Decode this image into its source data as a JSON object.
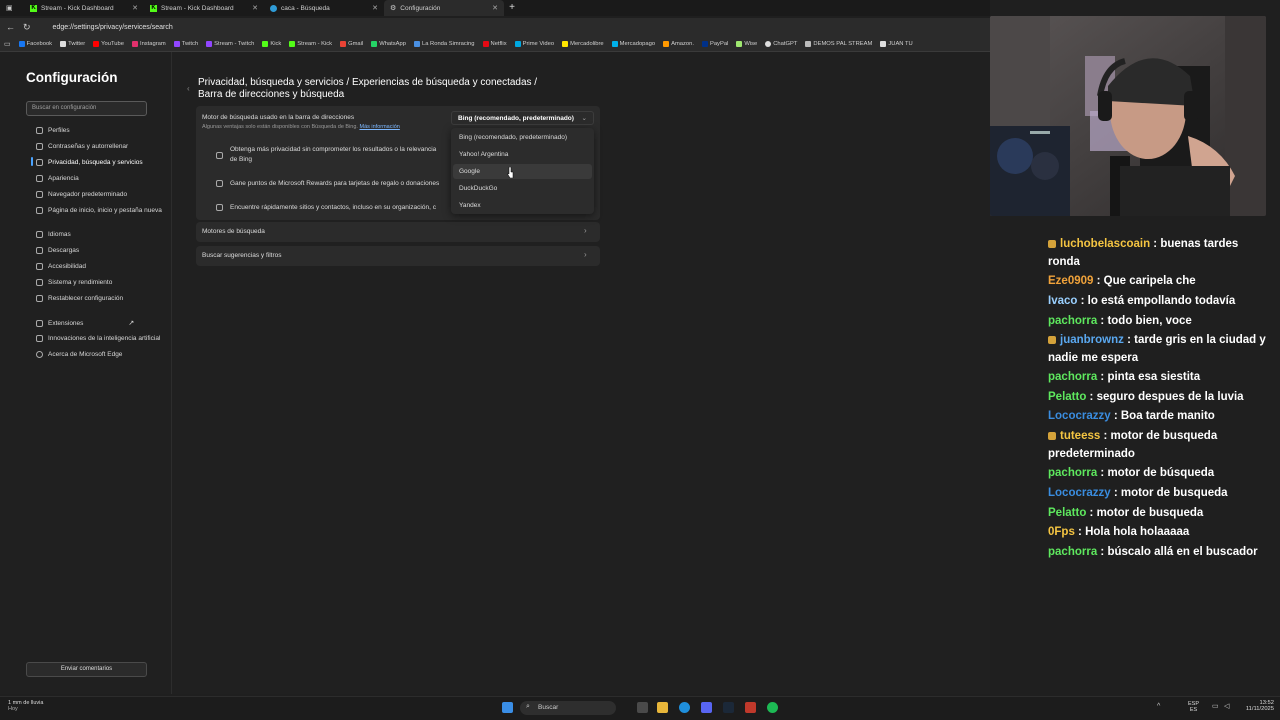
{
  "browser": {
    "tabs": [
      {
        "label": "Stream - Kick Dashboard",
        "icon": "kick-icon"
      },
      {
        "label": "Stream - Kick Dashboard",
        "icon": "kick-icon"
      },
      {
        "label": "caca - Búsqueda",
        "icon": "edge-icon"
      },
      {
        "label": "Configuración",
        "icon": "settings-icon"
      }
    ],
    "new_tab": "+",
    "url": "edge://settings/privacy/services/search",
    "bookmarks": [
      "Facebook",
      "Twitter",
      "YouTube",
      "Instagram",
      "Twitch",
      "Stream - Twitch",
      "Kick",
      "Stream - Kick",
      "Gmail",
      "WhatsApp",
      "La Ronda Simracing",
      "Netflix",
      "Prime Video",
      "Mercadolibre",
      "Mercadopago",
      "Amazon.",
      "PayPal",
      "Wise",
      "ChatGPT",
      "DEMOS PAL STREAM",
      "JUAN TU"
    ]
  },
  "settings": {
    "title": "Configuración",
    "search_placeholder": "Buscar en configuración",
    "nav_group1": [
      "Perfiles",
      "Contraseñas y autorrellenar",
      "Privacidad, búsqueda y servicios",
      "Apariencia",
      "Navegador predeterminado",
      "Página de inicio, inicio y pestaña nueva"
    ],
    "nav_group2": [
      "Idiomas",
      "Descargas",
      "Accesibilidad",
      "Sistema y rendimiento",
      "Restablecer configuración"
    ],
    "nav_group3": [
      "Extensiones",
      "Innovaciones de la inteligencia artificial",
      "Acerca de Microsoft Edge"
    ],
    "feedback_button": "Enviar comentarios",
    "breadcrumb_line1": "Privacidad, búsqueda y servicios  /  Experiencias de búsqueda y conectadas  /",
    "breadcrumb_line2": "Barra de direcciones y búsqueda",
    "engine_label": "Motor de búsqueda usado en la barra de direcciones",
    "engine_sub": "Algunas ventajas solo están disponibles con Búsqueda de Bing.",
    "engine_link": "Más información",
    "benefits": [
      "Obtenga más privacidad sin comprometer los resultados o la relevancia",
      "de Bing",
      "Gane puntos de Microsoft Rewards para tarjetas de regalo o donaciones",
      "Encuentre rápidamente sitios y contactos, incluso en su organización, c"
    ],
    "rows": [
      "Motores de búsqueda",
      "Buscar sugerencias y filtros"
    ],
    "dropdown_selected": "Bing (recomendado, predeterminado)",
    "dropdown_options": [
      "Bing (recomendado, predeterminado)",
      "Yahoo! Argentina",
      "Google",
      "DuckDuckGo",
      "Yandex"
    ]
  },
  "chat": [
    {
      "user": "luchobelascoain",
      "text": "buenas tardes ronda",
      "color": "#f5c542",
      "badge": true
    },
    {
      "user": "Eze0909",
      "text": "Que caripela che",
      "color": "#f0a23a"
    },
    {
      "user": "Ivaco",
      "text": "lo está empollando todavía",
      "color": "#9ad0ff"
    },
    {
      "user": "pachorra",
      "text": "todo bien, voce",
      "color": "#5ee85e"
    },
    {
      "user": "juanbrownz",
      "text": "tarde gris en la ciudad y nadie me espera",
      "color": "#5aa8f0",
      "badge": true
    },
    {
      "user": "pachorra",
      "text": "pinta esa siestita",
      "color": "#5ee85e"
    },
    {
      "user": "Pelatto",
      "text": "seguro despues de la luvia",
      "color": "#5ee85e"
    },
    {
      "user": "Lococrazzy",
      "text": "Boa tarde manito",
      "color": "#3a8de0"
    },
    {
      "user": "tuteess",
      "text": "motor de busqueda predeterminado",
      "color": "#f5c542",
      "badge": true
    },
    {
      "user": "pachorra",
      "text": "motor de búsqueda",
      "color": "#5ee85e"
    },
    {
      "user": "Lococrazzy",
      "text": "motor de busqueda",
      "color": "#3a8de0"
    },
    {
      "user": "Pelatto",
      "text": "motor de busqueda",
      "color": "#5ee85e"
    },
    {
      "user": "0Fps",
      "text": "Hola hola holaaaaa",
      "color": "#f5c542"
    },
    {
      "user": "pachorra",
      "text": "búscalo allá en el buscador",
      "color": "#5ee85e"
    }
  ],
  "taskbar": {
    "weather_line1": "1 mm de lluvia",
    "weather_line2": "Hoy",
    "search": "Buscar",
    "lang1": "ESP",
    "lang2": "ES",
    "time": "13:52",
    "date": "11/11/2025"
  }
}
